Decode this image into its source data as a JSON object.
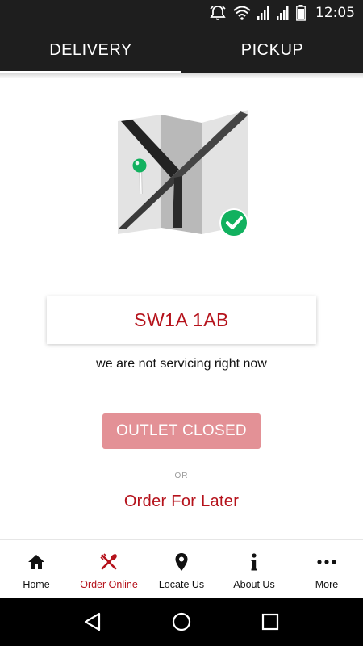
{
  "status_bar": {
    "time": "12:05"
  },
  "tabs": [
    {
      "label": "DELIVERY",
      "active": true
    },
    {
      "label": "PICKUP",
      "active": false
    }
  ],
  "location": {
    "postcode": "SW1A 1AB",
    "message": "we are not servicing right now"
  },
  "actions": {
    "outlet_status_label": "OUTLET CLOSED",
    "or_label": "OR",
    "order_later_label": "Order For Later"
  },
  "bottom_nav": [
    {
      "label": "Home",
      "icon": "home-icon",
      "active": false
    },
    {
      "label": "Order Online",
      "icon": "cutlery-icon",
      "active": true
    },
    {
      "label": "Locate Us",
      "icon": "location-pin-icon",
      "active": false
    },
    {
      "label": "About Us",
      "icon": "info-icon",
      "active": false
    },
    {
      "label": "More",
      "icon": "more-icon",
      "active": false
    }
  ],
  "colors": {
    "accent": "#b5121b",
    "disabled_button": "#e39196",
    "header": "#1e1e1e",
    "success": "#12b15f"
  }
}
